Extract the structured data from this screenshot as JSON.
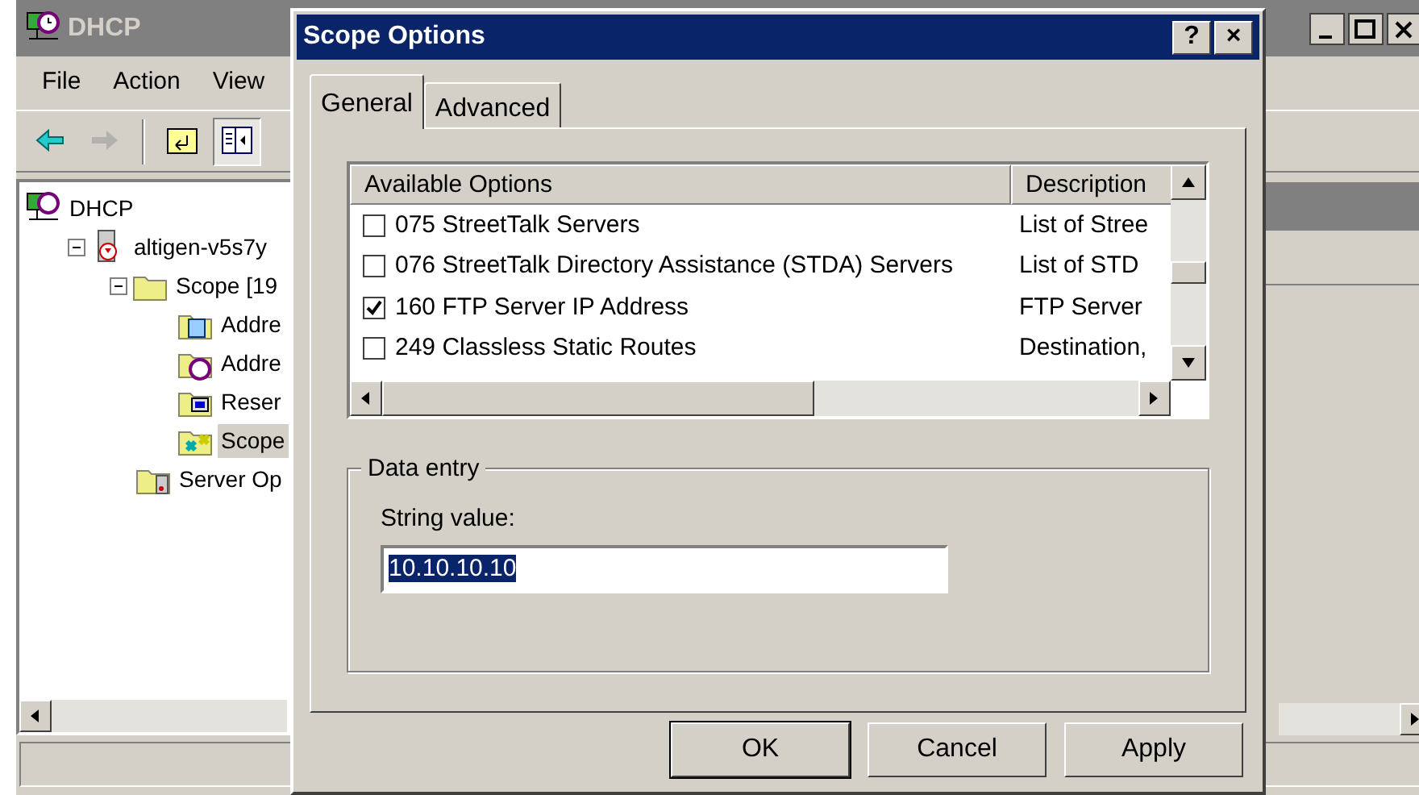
{
  "main_window": {
    "title": "DHCP",
    "menu": [
      "File",
      "Action",
      "View"
    ],
    "toolbar": [
      {
        "kind": "back",
        "disabled": false
      },
      {
        "kind": "forward",
        "disabled": true
      },
      {
        "kind": "up",
        "disabled": false
      },
      {
        "kind": "pane",
        "disabled": false,
        "pressed": true
      }
    ],
    "tree": [
      {
        "label": "DHCP",
        "kind": "dhcp",
        "selected": false,
        "children": [
          {
            "label": "altigen-v5s7y",
            "kind": "server",
            "selected": false,
            "expanded": true,
            "children": [
              {
                "label": "Scope [19",
                "kind": "folder",
                "selected": false,
                "expanded": true,
                "children": [
                  {
                    "label": "Addre",
                    "kind": "pool",
                    "selected": false
                  },
                  {
                    "label": "Addre",
                    "kind": "leases",
                    "selected": false
                  },
                  {
                    "label": "Reser",
                    "kind": "reservations",
                    "selected": false
                  },
                  {
                    "label": "Scope",
                    "kind": "options",
                    "selected": true
                  }
                ]
              },
              {
                "label": "Server Op",
                "kind": "server-options",
                "selected": false
              }
            ]
          }
        ]
      }
    ]
  },
  "dialog": {
    "title": "Scope Options",
    "title_buttons": [
      "?",
      "×"
    ],
    "tabs": [
      {
        "label": "General",
        "selected": true
      },
      {
        "label": "Advanced",
        "selected": false
      }
    ],
    "options_list": {
      "columns": [
        "Available Options",
        "Description"
      ],
      "rows": [
        {
          "name": "075 StreetTalk Servers",
          "description": "List of Stree",
          "checked": false
        },
        {
          "name": "076 StreetTalk Directory Assistance (STDA) Servers",
          "description": "List of STD",
          "checked": false
        },
        {
          "name": "160 FTP Server IP Address",
          "description": "FTP Server",
          "checked": true
        },
        {
          "name": "249 Classless Static Routes",
          "description": "Destination,",
          "checked": false
        }
      ]
    },
    "data_entry": {
      "title": "Data entry",
      "label": "String value:",
      "value": "10.10.10.10",
      "value_selected": true
    },
    "buttons": [
      {
        "label": "OK",
        "default": true
      },
      {
        "label": "Cancel",
        "default": false
      },
      {
        "label": "Apply",
        "default": false
      }
    ]
  }
}
